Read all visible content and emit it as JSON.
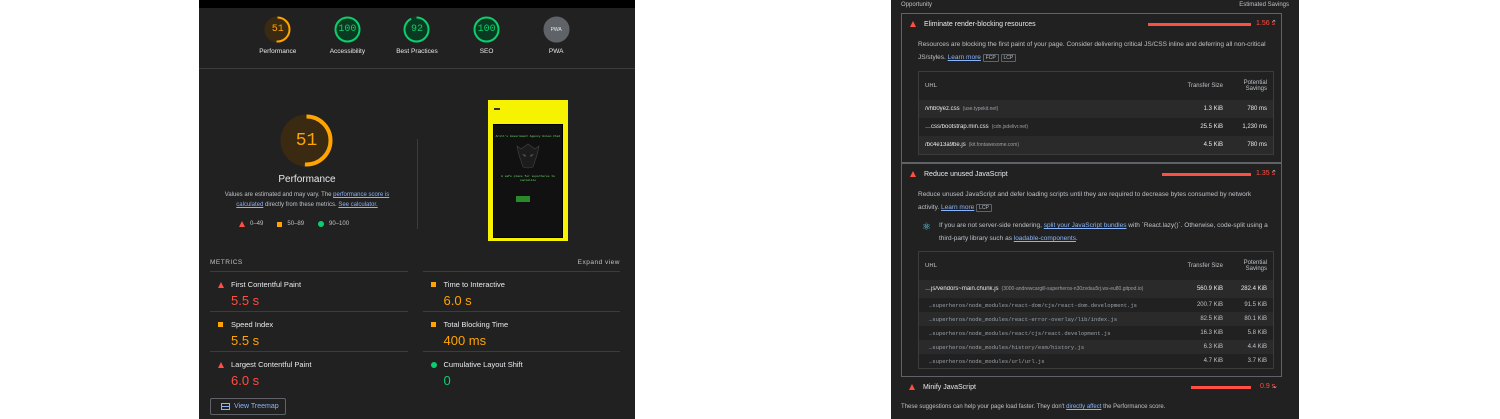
{
  "gauges": [
    {
      "value": "51",
      "label": "Performance",
      "color": "#ffa400",
      "fill": 0.51
    },
    {
      "value": "100",
      "label": "Accessibility",
      "color": "#0cce6b",
      "fill": 1.0
    },
    {
      "value": "92",
      "label": "Best Practices",
      "color": "#0cce6b",
      "fill": 0.92
    },
    {
      "value": "100",
      "label": "SEO",
      "color": "#0cce6b",
      "fill": 1.0
    },
    {
      "value": "PWA",
      "label": "PWA",
      "color": "#9aa0a6",
      "fill": 0
    }
  ],
  "performance": {
    "score": "51",
    "title": "Performance",
    "desc_pre": "Values are estimated and may vary. The ",
    "desc_link1": "performance score is calculated",
    "desc_mid": " directly from these metrics. ",
    "desc_link2": "See calculator.",
    "legend": [
      "0–49",
      "50–89",
      "90–100"
    ]
  },
  "screenshot": {
    "heading": "Arill's Government Agency Union Chat",
    "tagline": "A safe place for superheros to socialize",
    "button": "Join"
  },
  "metrics": {
    "heading": "METRICS",
    "expand": "Expand view",
    "items": [
      {
        "name": "First Contentful Paint",
        "value": "5.5 s",
        "status": "red"
      },
      {
        "name": "Time to Interactive",
        "value": "6.0 s",
        "status": "orange"
      },
      {
        "name": "Speed Index",
        "value": "5.5 s",
        "status": "orange"
      },
      {
        "name": "Total Blocking Time",
        "value": "400 ms",
        "status": "orange"
      },
      {
        "name": "Largest Contentful Paint",
        "value": "6.0 s",
        "status": "red"
      },
      {
        "name": "Cumulative Layout Shift",
        "value": "0",
        "status": "green"
      }
    ],
    "treemap": "View Treemap"
  },
  "opportunities": {
    "col_opportunity": "Opportunity",
    "col_savings": "Estimated Savings",
    "audit1": {
      "title": "Eliminate render-blocking resources",
      "savings": "1.56 s",
      "desc": "Resources are blocking the first paint of your page. Consider delivering critical JS/CSS inline and deferring all non-critical JS/styles. ",
      "learn": "Learn more",
      "pills": [
        "FCP",
        "LCP"
      ],
      "th": [
        "URL",
        "Transfer Size",
        "Potential Savings"
      ],
      "rows": [
        {
          "url": "/vhb0yez.css",
          "host": "(use.typekit.net)",
          "size": "1.3 KiB",
          "savings": "780 ms"
        },
        {
          "url": "…css/bootstrap.min.css",
          "host": "(cdn.jsdelivr.net)",
          "size": "25.5 KiB",
          "savings": "1,230 ms"
        },
        {
          "url": "/bc4e13a9be.js",
          "host": "(kit.fontawesome.com)",
          "size": "4.5 KiB",
          "savings": "780 ms"
        }
      ]
    },
    "audit2": {
      "title": "Reduce unused JavaScript",
      "savings": "1.35 s",
      "desc": "Reduce unused JavaScript and defer loading scripts until they are required to decrease bytes consumed by network activity. ",
      "learn": "Learn more",
      "pills": [
        "LCP"
      ],
      "tip_pre": "If you are not server-side rendering, ",
      "tip_link": "split your JavaScript bundles",
      "tip_mid": " with `React.lazy()`. Otherwise, code-split using a third-party library such as ",
      "tip_link2": "loadable-components",
      "tip_post": ".",
      "th": [
        "URL",
        "Transfer Size",
        "Potential Savings"
      ],
      "main_row": {
        "url": "…js/vendors~main.chunk.js",
        "host": "(3000-andrewcargill-superheros-n30zvdau5rj.ws-eu80.gitpod.io)",
        "size": "560.9 KiB",
        "savings": "282.4 KiB"
      },
      "sub_rows": [
        {
          "url": "…superheros/node_modules/react-dom/cjs/react-dom.development.js",
          "size": "200.7 KiB",
          "savings": "91.5 KiB"
        },
        {
          "url": "…superheros/node_modules/react-error-overlay/lib/index.js",
          "size": "82.5 KiB",
          "savings": "80.1 KiB"
        },
        {
          "url": "…superheros/node_modules/react/cjs/react.development.js",
          "size": "16.3 KiB",
          "savings": "5.8 KiB"
        },
        {
          "url": "…superheros/node_modules/history/esm/history.js",
          "size": "6.3 KiB",
          "savings": "4.4 KiB"
        },
        {
          "url": "…superheros/node_modules/url/url.js",
          "size": "4.7 KiB",
          "savings": "3.7 KiB"
        }
      ]
    },
    "audit3": {
      "title": "Minify JavaScript",
      "savings": "0.9 s"
    },
    "footer_pre": "These suggestions can help your page load faster. They don't ",
    "footer_link": "directly affect",
    "footer_post": " the Performance score."
  }
}
